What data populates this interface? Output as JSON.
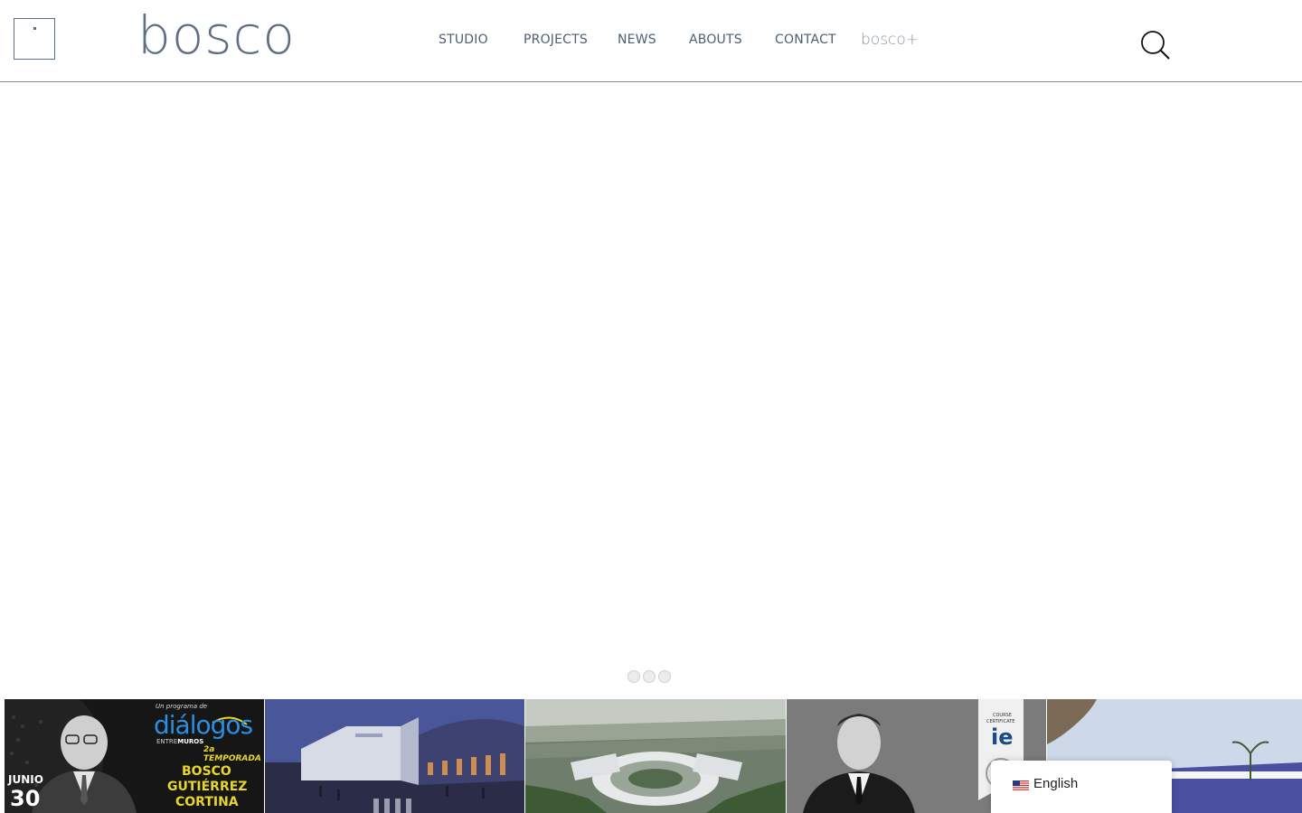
{
  "logo": {
    "text": "bosco"
  },
  "nav": {
    "studio": "STUDIO",
    "projects": "PROJECTS",
    "news": "NEWS",
    "abouts": "ABOUTS",
    "contact": "CONTACT",
    "bosco_plus": "bosco+"
  },
  "slider": {
    "dot_count": 3
  },
  "thumbnails": {
    "t1": {
      "kicker": "Un programa de",
      "brand_top": "diálogos",
      "brand_sub_a": "ENTRE",
      "brand_sub_b": "MUROS",
      "season": "2a TEMPORADA",
      "name_1": "BOSCO",
      "name_2": "GUTIÉRREZ",
      "name_3": "CORTINA",
      "month": "JUNIO",
      "day": "30"
    },
    "t4": {
      "cert_1": "COURSE",
      "cert_2": "CERTIFICATE",
      "cert_logo": "ie"
    }
  },
  "language": {
    "label": "English",
    "flag_icon": "us-flag-icon"
  },
  "colors": {
    "brand": "#5d6f84",
    "accent_yellow": "#e8d62a",
    "accent_blue": "#2a8fe0"
  }
}
